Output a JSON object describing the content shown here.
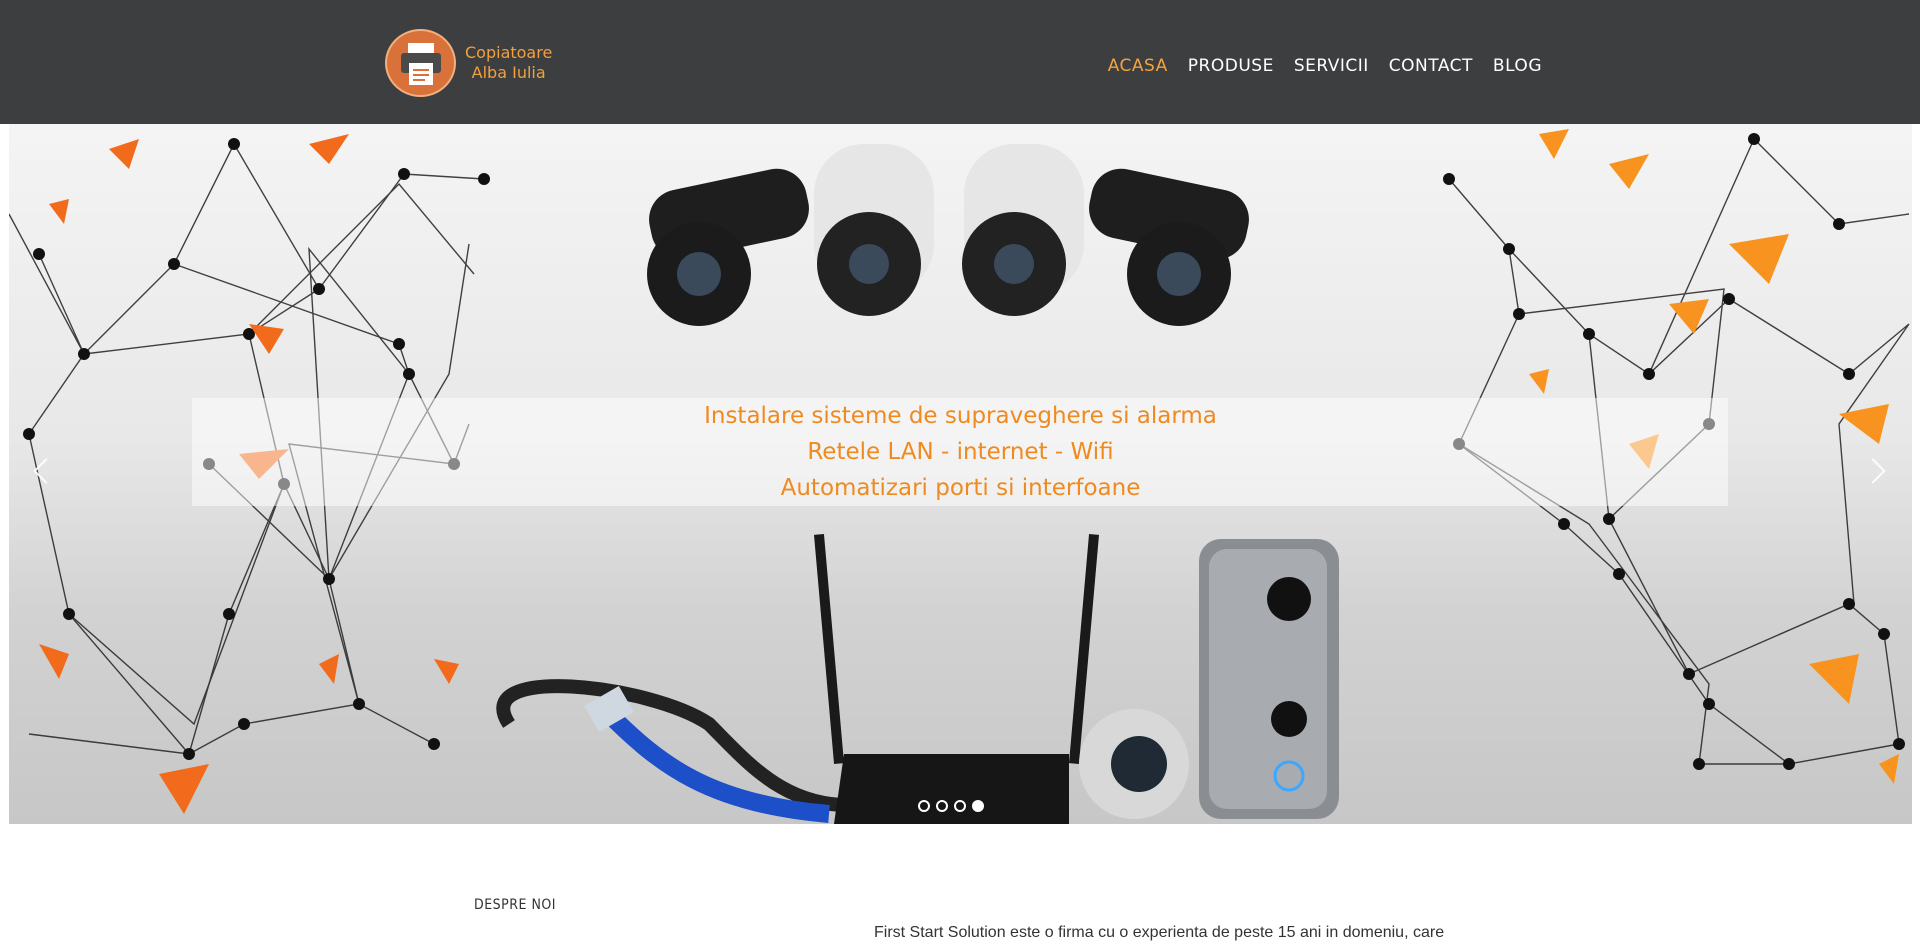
{
  "header": {
    "logo": {
      "line1": "Copiatoare",
      "line2": "Alba Iulia"
    },
    "nav": [
      {
        "label": "ACASA",
        "active": true
      },
      {
        "label": "PRODUSE",
        "active": false
      },
      {
        "label": "SERVICII",
        "active": false
      },
      {
        "label": "CONTACT",
        "active": false
      },
      {
        "label": "BLOG",
        "active": false
      }
    ]
  },
  "slider": {
    "caption": [
      "Instalare sisteme de supraveghere si alarma",
      "Retele LAN - internet - Wifi",
      "Automatizari porti si interfoane"
    ],
    "slide_count": 4,
    "active_slide": 4,
    "prev_icon": "chevron-left-icon",
    "next_icon": "chevron-right-icon"
  },
  "about": {
    "label": "DESPRE NOI",
    "text": "First Start Solution este o firma cu o experienta de peste 15 ani in domeniu, care"
  },
  "colors": {
    "header_bg": "#3d3e40",
    "accent": "#f3a43c",
    "caption": "#f08a1f"
  }
}
